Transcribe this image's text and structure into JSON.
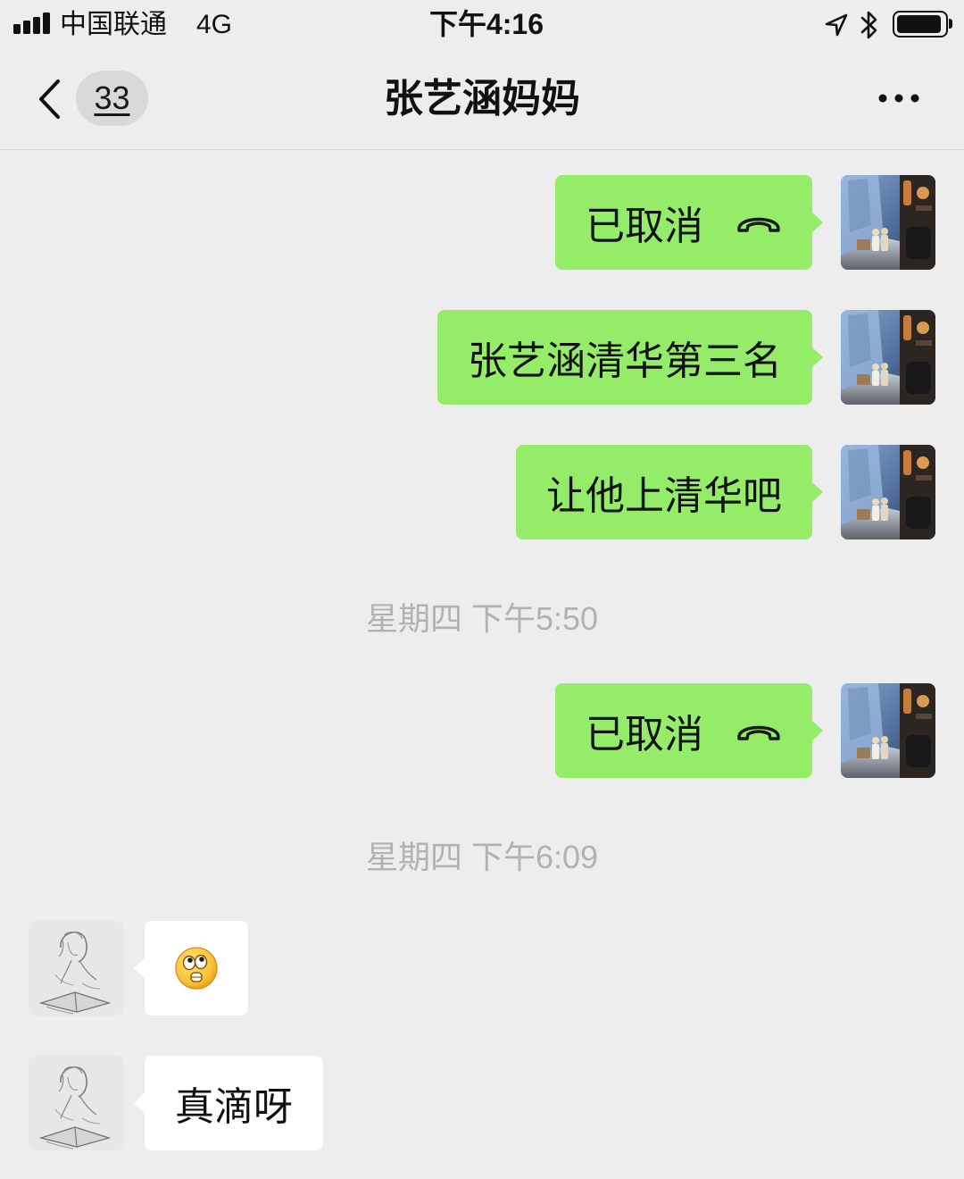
{
  "status_bar": {
    "signal_icon": "cellular-signal-icon",
    "signal_bars": 4,
    "carrier": "中国联通",
    "network": "4G",
    "time": "下午4:16",
    "location_icon": "location-arrow-icon",
    "bluetooth_icon": "bluetooth-icon",
    "battery_icon": "battery-icon",
    "battery_level": 0.95
  },
  "nav_bar": {
    "back_icon": "chevron-left-icon",
    "unread_count": "33",
    "title": "张艺涵妈妈",
    "more_icon": "more-dots-icon"
  },
  "messages": [
    {
      "outgoing": true,
      "text": "已取消",
      "icon": "phone-hangup-icon"
    },
    {
      "outgoing": true,
      "text": "张艺涵清华第三名"
    },
    {
      "outgoing": true,
      "text": "让他上清华吧"
    },
    {
      "timestamp": "星期四 下午5:50"
    },
    {
      "outgoing": true,
      "text": "已取消",
      "icon": "phone-hangup-icon"
    },
    {
      "timestamp": "星期四 下午6:09"
    },
    {
      "outgoing": false,
      "icon": "surprised-face-emoji-icon"
    },
    {
      "outgoing": false,
      "text": "真滴呀"
    }
  ],
  "colors": {
    "background": "#ededed",
    "bubble_self": "#95ec69",
    "bubble_other": "#ffffff",
    "timestamp": "#b2b2b2",
    "badge": "#d9d9d9",
    "text": "#1a1a1a"
  }
}
